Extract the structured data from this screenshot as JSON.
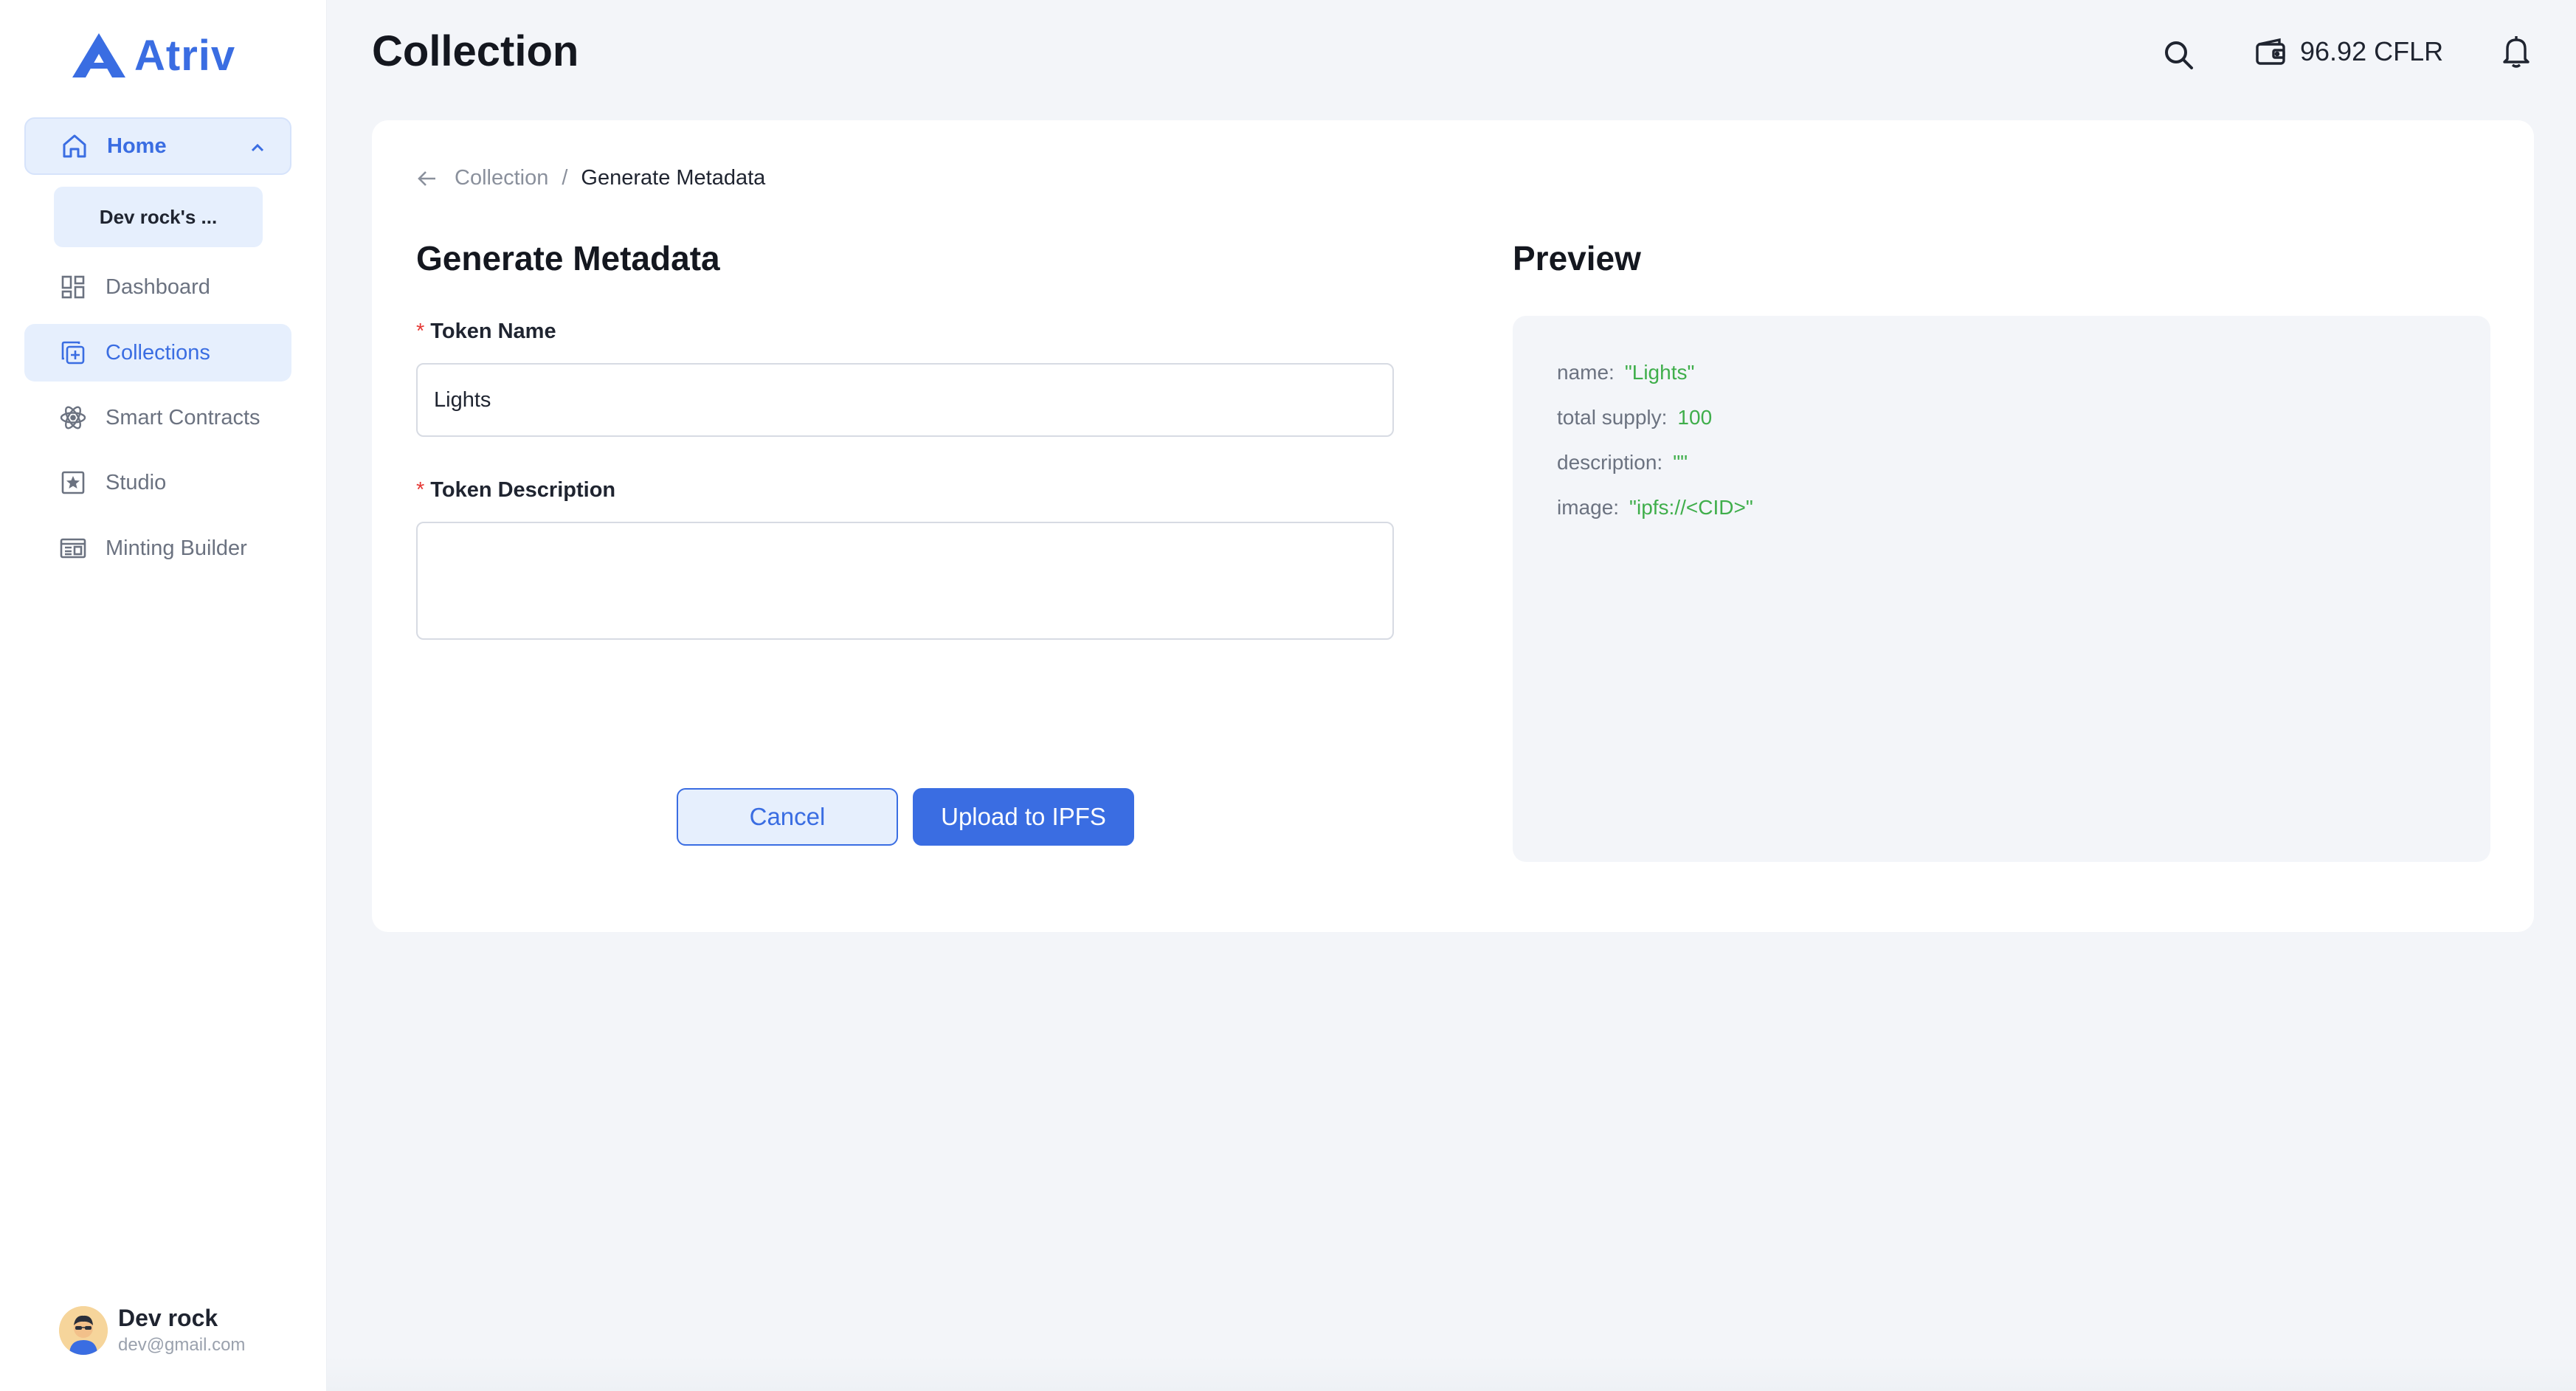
{
  "app": {
    "name": "Atriv",
    "brand_color": "#3a6de2"
  },
  "sidebar": {
    "home": {
      "label": "Home",
      "icon": "home-icon",
      "expanded": true
    },
    "home_sub_item": "Dev rock's ...",
    "items": [
      {
        "label": "Dashboard",
        "icon": "dashboard-icon",
        "active": false
      },
      {
        "label": "Collections",
        "icon": "collections-icon",
        "active": true
      },
      {
        "label": "Smart Contracts",
        "icon": "atom-icon",
        "active": false
      },
      {
        "label": "Studio",
        "icon": "star-square-icon",
        "active": false
      },
      {
        "label": "Minting Builder",
        "icon": "builder-icon",
        "active": false
      }
    ],
    "user": {
      "name": "Dev rock",
      "email": "dev@gmail.com"
    }
  },
  "header": {
    "title": "Collection",
    "wallet_balance": "96.92 CFLR"
  },
  "breadcrumb": {
    "parent": "Collection",
    "separator": "/",
    "current": "Generate Metadata"
  },
  "form": {
    "title": "Generate Metadata",
    "required_mark": "*",
    "token_name": {
      "label": "Token Name",
      "value": "Lights"
    },
    "token_description": {
      "label": "Token Description",
      "value": ""
    },
    "cancel_label": "Cancel",
    "upload_label": "Upload to IPFS"
  },
  "preview": {
    "title": "Preview",
    "rows": [
      {
        "key": "name:",
        "value": "\"Lights\""
      },
      {
        "key": "total supply:",
        "value": "100"
      },
      {
        "key": "description:",
        "value": "\"\""
      },
      {
        "key": "image:",
        "value": "\"ipfs://<CID>\""
      }
    ],
    "value_color": "#3fae4b"
  }
}
